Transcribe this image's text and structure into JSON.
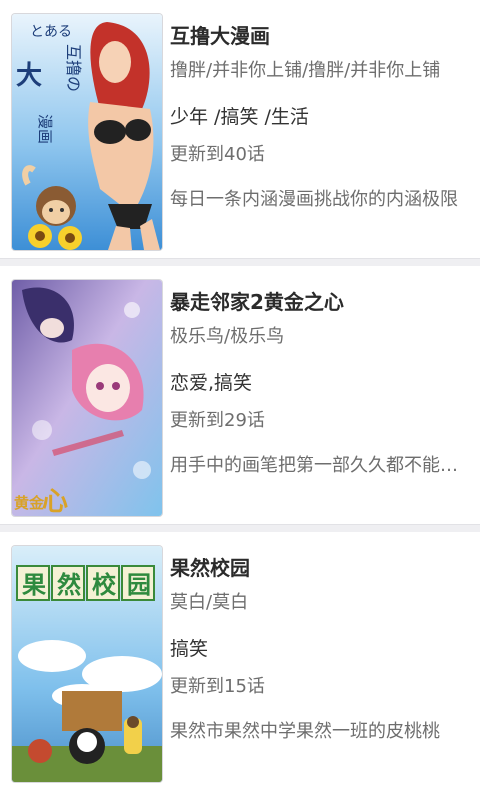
{
  "comics": [
    {
      "title": "互撸大漫画",
      "author": "撸胖/并非你上铺/撸胖/并非你上铺",
      "tags": "少年 /搞笑 /生活",
      "update": "更新到40话",
      "description": "每日一条内涵漫画挑战你的内涵极限",
      "cover_text": [
        "とある",
        "互撸の",
        "大",
        "漫画"
      ]
    },
    {
      "title": "暴走邻家2黄金之心",
      "author": "极乐鸟/极乐鸟",
      "tags": "恋爱,搞笑",
      "update": "更新到29话",
      "description": "用手中的画笔把第一部久久都不能忘怀",
      "cover_text": [
        "黄金",
        "心"
      ]
    },
    {
      "title": "果然校园",
      "author": "莫白/莫白",
      "tags": "搞笑",
      "update": "更新到15话",
      "description": "果然市果然中学果然一班的皮桃桃",
      "cover_text": [
        "果",
        "然",
        "校",
        "园"
      ]
    }
  ]
}
